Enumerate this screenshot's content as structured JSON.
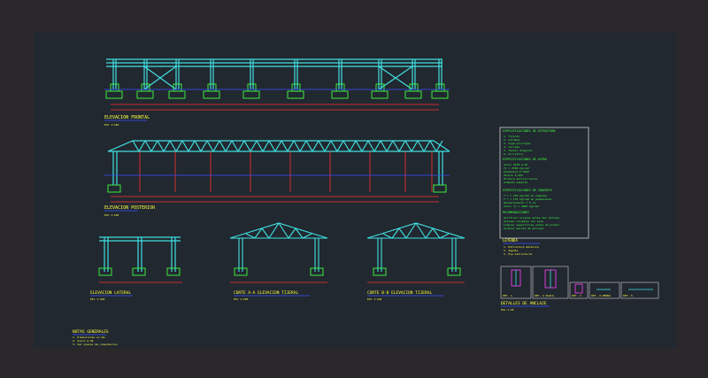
{
  "drawing": {
    "background": "#212830",
    "frame_color": "#2b282b",
    "colors": {
      "structure": "#40e0e0",
      "dimension": "#ff3030",
      "axis": "#3a50ff",
      "footing": "#40ff40",
      "note": "#ffff40",
      "spec": "#40ff40",
      "title_underline": "#3a50ff",
      "hatch": "#ff40ff"
    }
  },
  "views": {
    "frontal_elevation": {
      "title": "ELEVACION FRONTAL",
      "scale": "ESC 1:100"
    },
    "rear_elevation": {
      "title": "ELEVACION POSTERIOR",
      "scale": "ESC 1:100"
    },
    "side_elevation": {
      "title": "ELEVACION LATERAL",
      "scale": "ESC 1:100"
    },
    "section_a": {
      "title": "CORTE A-A ELEVACION TIJERAL",
      "scale": "ESC 1:100"
    },
    "section_b": {
      "title": "CORTE B-B ELEVACION TIJERAL",
      "scale": "ESC 1:100"
    },
    "details": {
      "title": "DETALLES DE ANCLAJE",
      "scale": "ESC 1:20"
    }
  },
  "general_notes": {
    "title": "NOTAS GENERALES",
    "lines": [
      "1. Dimensiones en mm.",
      "2. Acero A-36",
      "3. Ver planos de cimentacion"
    ]
  },
  "specs_box": {
    "heading1": "ESPECIFICACIONES DE ESTRUCTURA",
    "list1": [
      "1. Tijeral",
      "2. Columna",
      "3. Viga principal",
      "4. Correas",
      "5. Tensor diagonal",
      "6. Arriostre"
    ],
    "heading2": "ESPECIFICACIONES DE ACERO",
    "list2": [
      "Acero ASTM A-36",
      "fy = 2530 kg/cm2",
      "Soldadura E-70XX",
      "Pernos A-325",
      "Pintura anticorrosiva",
      "Acabado esmalte"
    ],
    "heading3": "ESPECIFICACIONES DE CONCRETO",
    "list3": [
      "f'c = 210 kg/cm2 en zapatas",
      "f'c = 175 kg/cm2 en pedestales",
      "Recubrimiento 7.5 cm",
      "Acero fy = 4200 kg/cm2"
    ],
    "heading4": "RECOMENDACIONES",
    "list4": [
      "Verificar niveles antes del montaje",
      "Alinear columnas con ejes",
      "Limpiar superficies antes de pintar",
      "Ajustar pernos de anclaje"
    ]
  },
  "legend": {
    "title": "LEYENDA",
    "lines": [
      "1. Estructura metalica",
      "2. Zapata",
      "3. Eje estructural"
    ]
  },
  "detail_labels": [
    "DET. 1",
    "DET. 2 PLACA",
    "DET. 3",
    "DET. 4 PERNO",
    "DET. 5"
  ]
}
